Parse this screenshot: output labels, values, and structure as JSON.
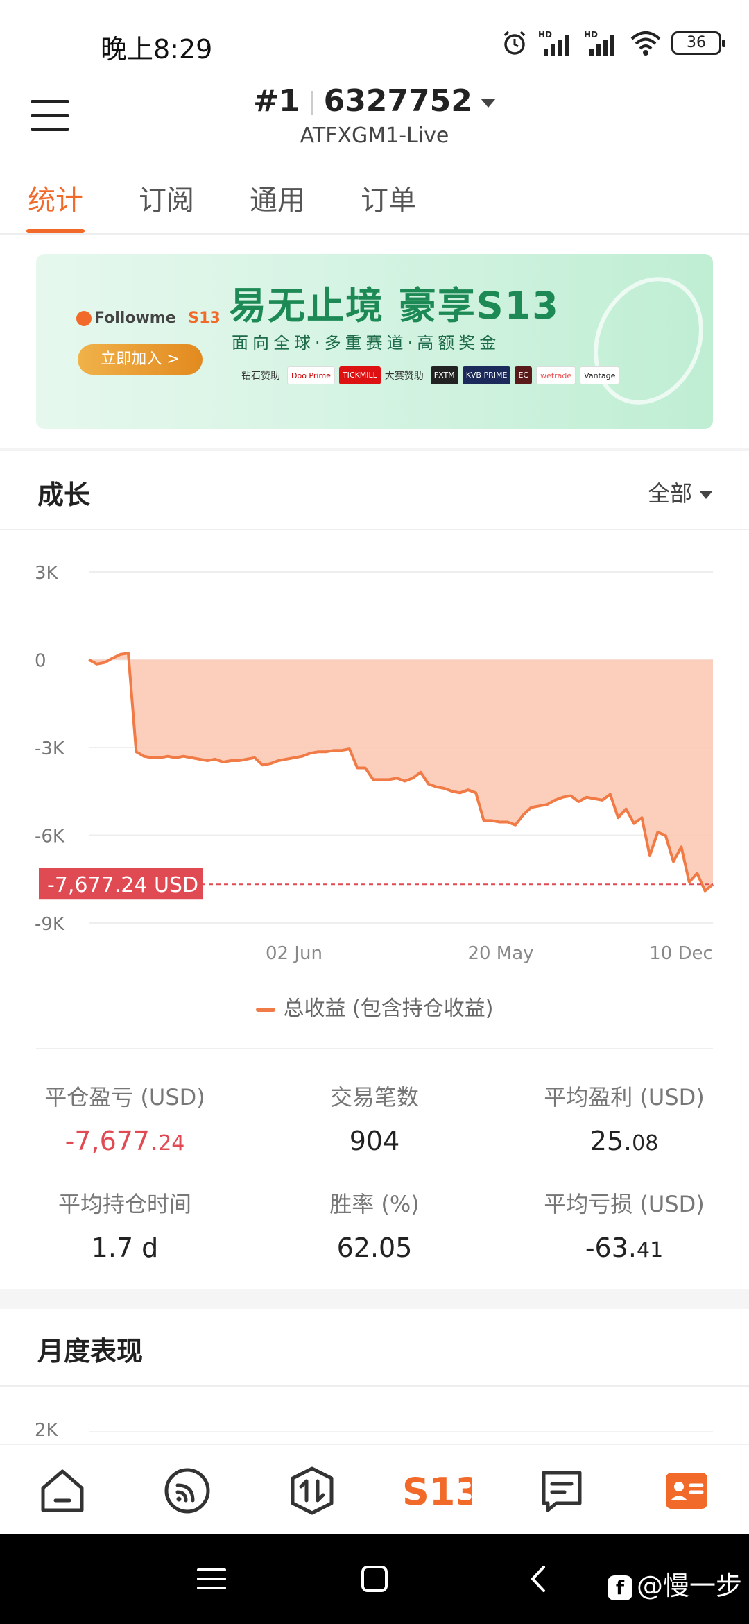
{
  "status_bar": {
    "time": "晚上8:29",
    "battery": "36",
    "icons": [
      "alarm-icon",
      "hd-signal-icon",
      "hd-signal-icon",
      "wifi-icon",
      "battery-icon"
    ]
  },
  "header": {
    "rank": "#1",
    "account_number": "6327752",
    "server": "ATFXGM1-Live"
  },
  "tabs": [
    {
      "label": "统计",
      "active": true
    },
    {
      "label": "订阅",
      "active": false
    },
    {
      "label": "通用",
      "active": false
    },
    {
      "label": "订单",
      "active": false
    }
  ],
  "banner": {
    "brand": "Followme",
    "brand_badge": "S13",
    "headline": "易无止境 豪享S13",
    "subline": "面向全球·多重赛道·高额奖金",
    "join_button": "立即加入 >",
    "sponsor_label_1": "钻石赞助",
    "sponsor_label_2": "大赛赞助",
    "sponsors": [
      "Doo Prime",
      "TICKMILL",
      "FXTM",
      "KVB PRIME",
      "EC",
      "wetrade",
      "Vantage"
    ]
  },
  "growth": {
    "title": "成长",
    "filter": "全部",
    "current_label": "-7,677.24 USD",
    "legend": "总收益 (包含持仓收益)"
  },
  "chart_data": {
    "type": "area",
    "y_ticks": [
      "3K",
      "0",
      "-3K",
      "-6K",
      "-9K"
    ],
    "x_ticks": [
      "02 Jun",
      "20 May",
      "10 Dec"
    ],
    "ylim": [
      -9000,
      3000
    ],
    "marker": {
      "value": -7677.24,
      "label": "-7,677.24 USD"
    },
    "color": "#f07b46",
    "fill": "#fbc7b0",
    "series": [
      {
        "name": "总收益 (包含持仓收益)",
        "values": [
          0,
          -150,
          -100,
          50,
          180,
          220,
          -3150,
          -3300,
          -3350,
          -3350,
          -3300,
          -3350,
          -3300,
          -3350,
          -3400,
          -3450,
          -3400,
          -3500,
          -3450,
          -3450,
          -3400,
          -3350,
          -3600,
          -3550,
          -3450,
          -3400,
          -3350,
          -3300,
          -3200,
          -3150,
          -3150,
          -3100,
          -3100,
          -3050,
          -3700,
          -3700,
          -4100,
          -4100,
          -4100,
          -4050,
          -4150,
          -4050,
          -3850,
          -4250,
          -4350,
          -4400,
          -4500,
          -4550,
          -4450,
          -4550,
          -5500,
          -5500,
          -5550,
          -5550,
          -5650,
          -5300,
          -5050,
          -5000,
          -4950,
          -4800,
          -4700,
          -4650,
          -4850,
          -4700,
          -4750,
          -4800,
          -4600,
          -5400,
          -5100,
          -5600,
          -5400,
          -6700,
          -5900,
          -6000,
          -6900,
          -6400,
          -7600,
          -7300,
          -7900,
          -7677
        ]
      }
    ]
  },
  "stats": [
    {
      "label": "平仓盈亏 (USD)",
      "int": "-7,677.",
      "dec": "24",
      "negative": true
    },
    {
      "label": "交易笔数",
      "int": "904",
      "dec": "",
      "negative": false
    },
    {
      "label": "平均盈利 (USD)",
      "int": "25.",
      "dec": "08",
      "negative": false
    },
    {
      "label": "平均持仓时间",
      "int": "1.7 d",
      "dec": "",
      "negative": false
    },
    {
      "label": "胜率 (%)",
      "int": "62.05",
      "dec": "",
      "negative": false
    },
    {
      "label": "平均亏损 (USD)",
      "int": "-63.",
      "dec": "41",
      "negative": false
    }
  ],
  "monthly": {
    "title": "月度表现",
    "first_tick": "2K"
  },
  "bottom_nav": [
    {
      "name": "home",
      "icon": "home-icon"
    },
    {
      "name": "feed",
      "icon": "rss-icon"
    },
    {
      "name": "trade",
      "icon": "trade-icon"
    },
    {
      "name": "s13",
      "icon": "s13-icon",
      "label": "S13"
    },
    {
      "name": "messages",
      "icon": "message-icon"
    },
    {
      "name": "profile",
      "icon": "profile-card-icon",
      "active": true
    }
  ],
  "watermark": "@慢一步",
  "accent": "#f26a2a",
  "negative_color": "#e04a52"
}
